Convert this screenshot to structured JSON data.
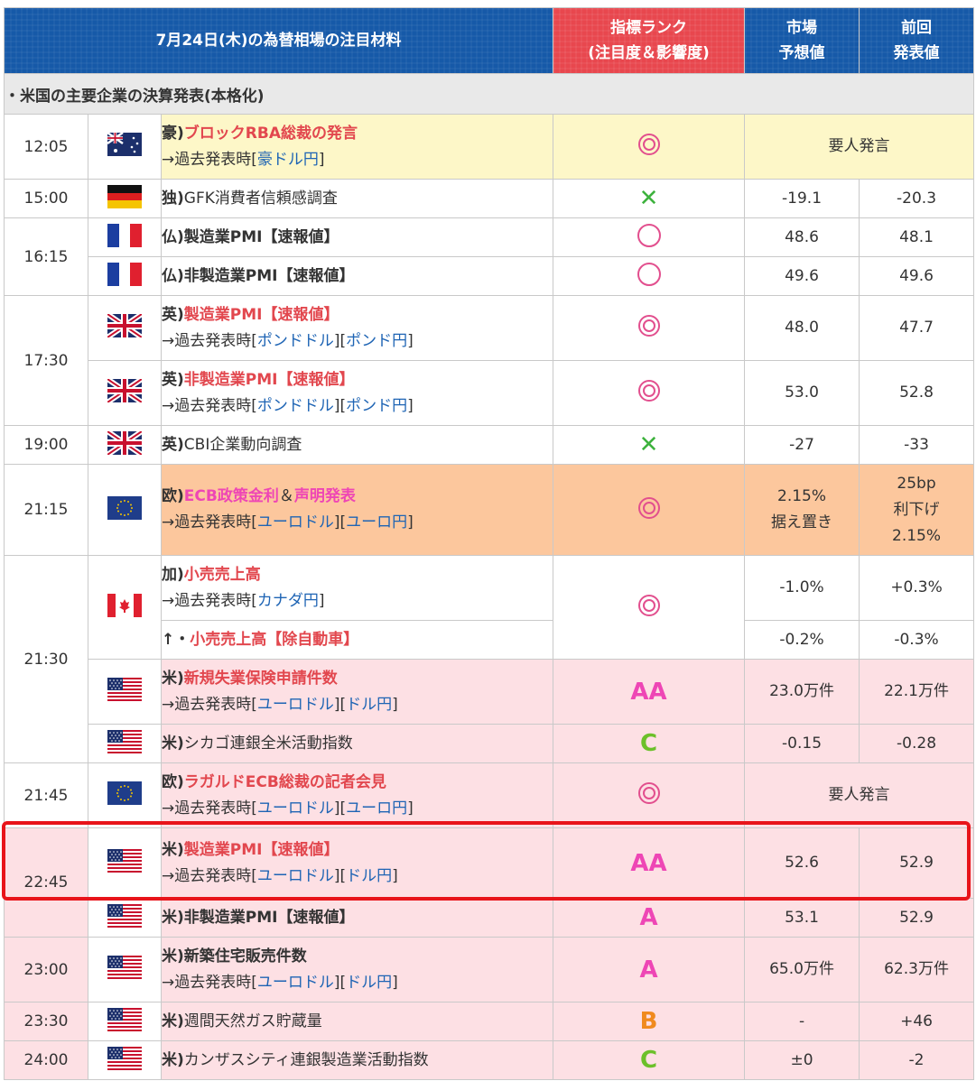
{
  "header": {
    "title": "7月24日(木)の為替相場の注目材料",
    "rank_label_1": "指標ランク",
    "rank_label_2": "(注目度＆影響度)",
    "forecast_label_1": "市場",
    "forecast_label_2": "予想値",
    "previous_label_1": "前回",
    "previous_label_2": "発表値"
  },
  "section_note": "・米国の主要企業の決算発表(本格化)",
  "rows": {
    "r1": {
      "time": "12:05",
      "flag": "australia-flag",
      "prefix": "豪)",
      "title": "ブロックRBA総裁の発言",
      "past_prefix": "→過去発表時[",
      "link1": "豪ドル円",
      "past_suffix": "]",
      "rank": "double-circle",
      "merged_value": "要人発言"
    },
    "r2": {
      "time": "15:00",
      "flag": "germany-flag",
      "prefix": "独)",
      "title": "GFK消費者信頼感調査",
      "rank": "cross",
      "forecast": "-19.1",
      "previous": "-20.3"
    },
    "r3": {
      "time": "16:15",
      "flag": "france-flag",
      "prefix": "仏)",
      "title": "製造業PMI【速報値】",
      "rank": "circle",
      "forecast": "48.6",
      "previous": "48.1"
    },
    "r4": {
      "flag": "france-flag",
      "prefix": "仏)",
      "title": "非製造業PMI【速報値】",
      "rank": "circle",
      "forecast": "49.6",
      "previous": "49.6"
    },
    "r5": {
      "time": "17:30",
      "flag": "uk-flag",
      "prefix": "英)",
      "title": "製造業PMI【速報値】",
      "past_prefix": "→過去発表時[",
      "link1": "ポンドドル",
      "mid": "][",
      "link2": "ポンド円",
      "past_suffix": "]",
      "rank": "double-circle",
      "forecast": "48.0",
      "previous": "47.7"
    },
    "r6": {
      "flag": "uk-flag",
      "prefix": "英)",
      "title": "非製造業PMI【速報値】",
      "past_prefix": "→過去発表時[",
      "link1": "ポンドドル",
      "mid": "][",
      "link2": "ポンド円",
      "past_suffix": "]",
      "rank": "double-circle",
      "forecast": "53.0",
      "previous": "52.8"
    },
    "r7": {
      "time": "19:00",
      "flag": "uk-flag",
      "prefix": "英)",
      "title": "CBI企業動向調査",
      "rank": "cross",
      "forecast": "-27",
      "previous": "-33"
    },
    "r8": {
      "time": "21:15",
      "flag": "eu-flag",
      "prefix": "欧)",
      "title": "ECB政策金利",
      "amp": "＆",
      "title2": "声明発表",
      "past_prefix": "→過去発表時[",
      "link1": "ユーロドル",
      "mid": "][",
      "link2": "ユーロ円",
      "past_suffix": "]",
      "rank": "double-circle",
      "forecast_1": "2.15%",
      "forecast_2": "据え置き",
      "previous_1": "25bp",
      "previous_2": "利下げ",
      "previous_3": "2.15%"
    },
    "r9": {
      "time": "21:30",
      "flag": "canada-flag",
      "prefix": "加)",
      "title": "小売売上高",
      "past_prefix": "→過去発表時[",
      "link1": "カナダ円",
      "past_suffix": "]",
      "rank": "double-circle",
      "forecast": "-1.0%",
      "previous": "+0.3%"
    },
    "r10": {
      "prefix": "↑・",
      "title": "小売売上高【除自動車】",
      "forecast": "-0.2%",
      "previous": "-0.3%"
    },
    "r11": {
      "flag": "us-flag",
      "prefix": "米)",
      "title": "新規失業保険申請件数",
      "past_prefix": "→過去発表時[",
      "link1": "ユーロドル",
      "mid": "][",
      "link2": "ドル円",
      "past_suffix": "]",
      "rank": "AA",
      "forecast": "23.0万件",
      "previous": "22.1万件"
    },
    "r12": {
      "flag": "us-flag",
      "prefix": "米)",
      "title": "シカゴ連銀全米活動指数",
      "rank": "C",
      "forecast": "-0.15",
      "previous": "-0.28"
    },
    "r13": {
      "time": "21:45",
      "flag": "eu-flag",
      "prefix": "欧)",
      "title": "ラガルドECB総裁の記者会見",
      "past_prefix": "→過去発表時[",
      "link1": "ユーロドル",
      "mid": "][",
      "link2": "ユーロ円",
      "past_suffix": "]",
      "rank": "double-circle",
      "merged_value": "要人発言"
    },
    "r14": {
      "time": "22:45",
      "flag": "us-flag",
      "prefix": "米)",
      "title": "製造業PMI【速報値】",
      "past_prefix": "→過去発表時[",
      "link1": "ユーロドル",
      "mid": "][",
      "link2": "ドル円",
      "past_suffix": "]",
      "rank": "AA",
      "forecast": "52.6",
      "previous": "52.9"
    },
    "r15": {
      "flag": "us-flag",
      "prefix": "米)",
      "title": "非製造業PMI【速報値】",
      "rank": "A",
      "forecast": "53.1",
      "previous": "52.9"
    },
    "r16": {
      "time": "23:00",
      "flag": "us-flag",
      "prefix": "米)",
      "title": "新築住宅販売件数",
      "past_prefix": "→過去発表時[",
      "link1": "ユーロドル",
      "mid": "][",
      "link2": "ドル円",
      "past_suffix": "]",
      "rank": "A",
      "forecast": "65.0万件",
      "previous": "62.3万件"
    },
    "r17": {
      "time": "23:30",
      "flag": "us-flag",
      "prefix": "米)",
      "title": "週間天然ガス貯蔵量",
      "rank": "B",
      "forecast": "-",
      "previous": "+46"
    },
    "r18": {
      "time": "24:00",
      "flag": "us-flag",
      "prefix": "米)",
      "title": "カンザスシティ連銀製造業活動指数",
      "rank": "C",
      "forecast": "±0",
      "previous": "-2"
    }
  },
  "colors": {
    "header_blue": "#1659a8",
    "header_red": "#e8474e",
    "highlight_red": "#e8141a",
    "yellow_row": "#fdf7c8",
    "orange_row": "#fcc79d",
    "pink_row": "#fde0e4"
  }
}
